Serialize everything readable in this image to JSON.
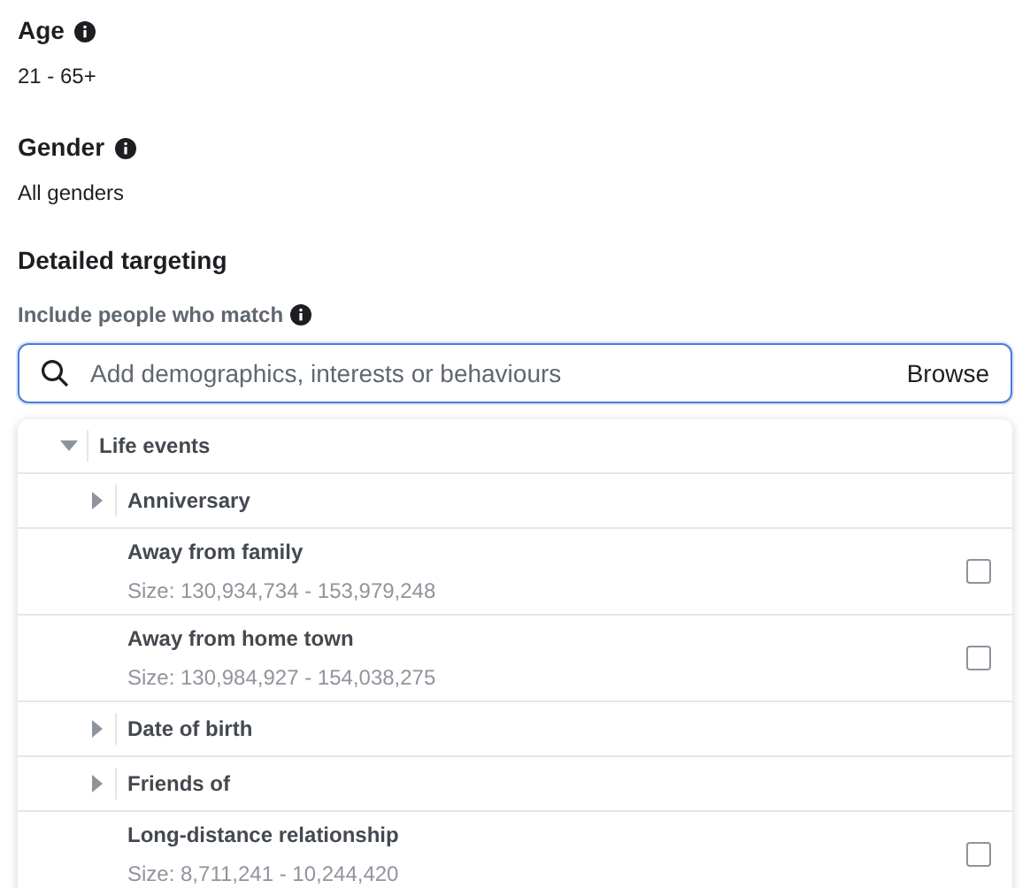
{
  "fields": [
    {
      "label": "Age",
      "value": "21 - 65+"
    },
    {
      "label": "Gender",
      "value": "All genders"
    }
  ],
  "detailed_targeting": {
    "title": "Detailed targeting",
    "hint": "Include people who match",
    "search": {
      "placeholder": "Add demographics, interests or behaviours",
      "action": "Browse"
    },
    "tree": [
      {
        "label": "Life events",
        "kind": "group",
        "expanded": true,
        "children": [
          {
            "label": "Anniversary",
            "kind": "group",
            "expanded": false
          },
          {
            "label": "Away from family",
            "kind": "option",
            "size": "Size: 130,934,734 - 153,979,248",
            "checked": false
          },
          {
            "label": "Away from home town",
            "kind": "option",
            "size": "Size: 130,984,927 - 154,038,275",
            "checked": false
          },
          {
            "label": "Date of birth",
            "kind": "group",
            "expanded": false
          },
          {
            "label": "Friends of",
            "kind": "group",
            "expanded": false
          },
          {
            "label": "Long-distance relationship",
            "kind": "option",
            "size": "Size: 8,711,241 - 10,244,420",
            "checked": false
          }
        ]
      }
    ]
  }
}
